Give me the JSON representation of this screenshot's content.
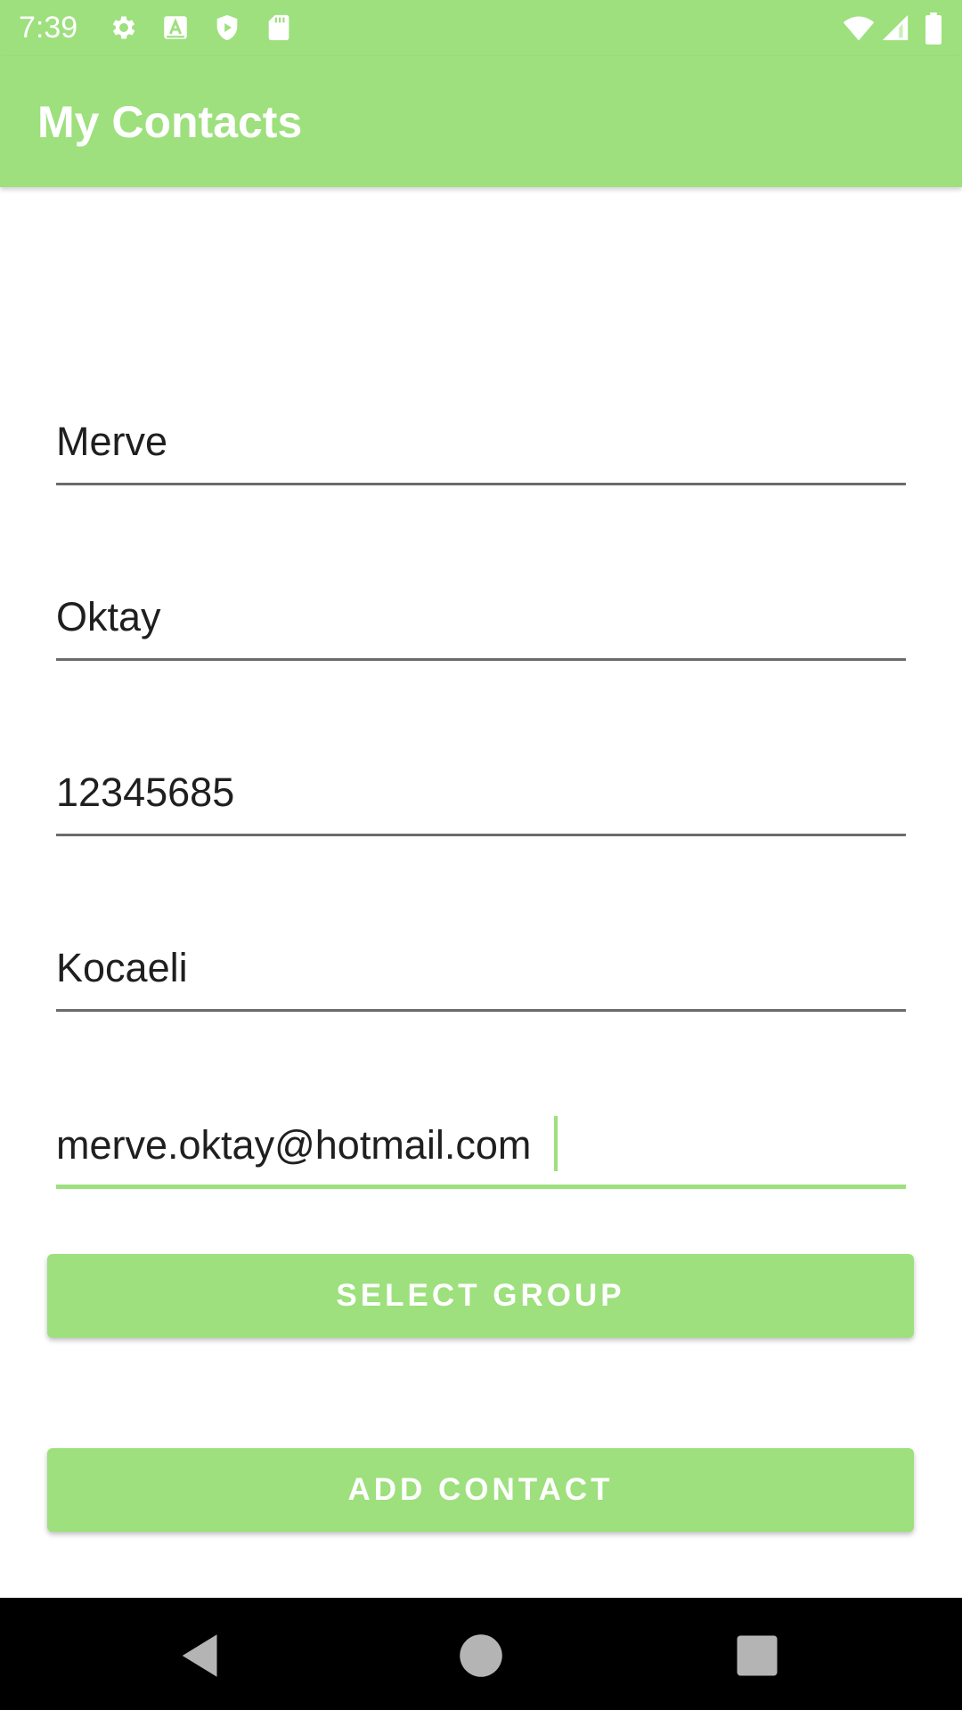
{
  "status_bar": {
    "time": "7:39",
    "icons": [
      "gear-icon",
      "font-a-icon",
      "shield-play-icon",
      "sd-card-icon",
      "wifi-icon",
      "cell-signal-icon",
      "battery-icon"
    ],
    "color": "#9de07d"
  },
  "app_bar": {
    "title": "My Contacts",
    "background": "#9de07d"
  },
  "form": {
    "first_name": "Merve",
    "last_name": "Oktay",
    "phone": "12345685",
    "city": "Kocaeli",
    "email": "merve.oktay@hotmail.com",
    "accent_color": "#9de07d"
  },
  "buttons": {
    "select_group": "SELECT GROUP",
    "add_contact": "ADD CONTACT"
  },
  "nav": {
    "icons": [
      "back-icon",
      "home-icon",
      "recents-icon"
    ]
  }
}
